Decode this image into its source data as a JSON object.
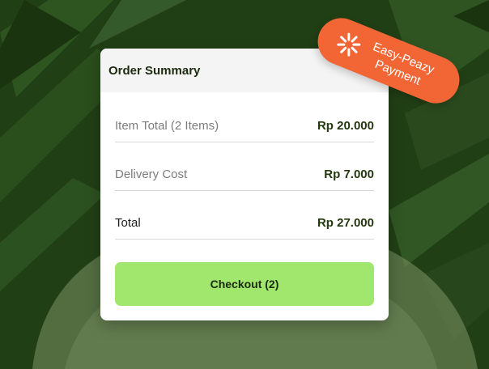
{
  "order_summary": {
    "title": "Order Summary",
    "rows": [
      {
        "label": "Item Total (2 Items)",
        "value": "Rp 20.000"
      },
      {
        "label": "Delivery Cost",
        "value": "Rp 7.000"
      },
      {
        "label": "Total",
        "value": "Rp 27.000"
      }
    ],
    "checkout_label": "Checkout (2)"
  },
  "badge": {
    "line1": "Easy-Peazy",
    "line2": "Payment",
    "icon": "sparkle-icon"
  },
  "colors": {
    "background": "#1f3f14",
    "checkout_button": "#a1e76d",
    "badge": "#f26535",
    "value_text": "#23380f"
  }
}
